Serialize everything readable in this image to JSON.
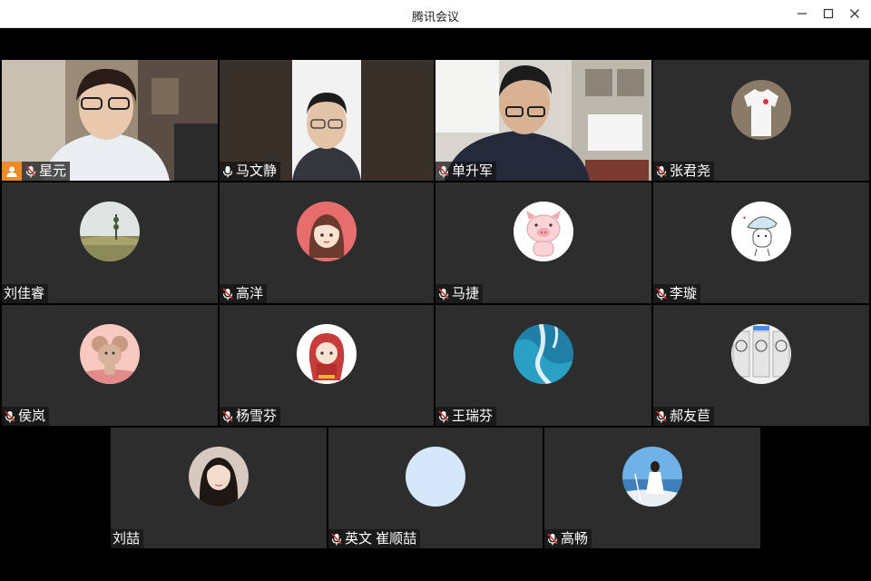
{
  "window": {
    "title": "腾讯会议"
  },
  "controls": [
    "minimize-icon",
    "maximize-icon",
    "close-icon"
  ],
  "participants": [
    {
      "name": "星元",
      "mic": "muted",
      "host": true,
      "video": true
    },
    {
      "name": "马文静",
      "mic": "on",
      "speaking": true,
      "video": true
    },
    {
      "name": "单升军",
      "mic": "muted",
      "video": true
    },
    {
      "name": "张君尧",
      "mic": "muted",
      "avatar": "shirt-avatar"
    },
    {
      "name": "刘佳睿",
      "mic": "none",
      "avatar": "landscape-avatar"
    },
    {
      "name": "高洋",
      "mic": "muted",
      "avatar": "cartoon-girl-avatar"
    },
    {
      "name": "马捷",
      "mic": "muted",
      "avatar": "pig-avatar"
    },
    {
      "name": "李璇",
      "mic": "muted",
      "avatar": "mushroom-avatar"
    },
    {
      "name": "侯岚",
      "mic": "muted",
      "avatar": "mouse-avatar"
    },
    {
      "name": "杨雪芬",
      "mic": "muted",
      "avatar": "red-hood-girl-avatar"
    },
    {
      "name": "王瑞芬",
      "mic": "muted",
      "avatar": "ocean-avatar"
    },
    {
      "name": "郝友苣",
      "mic": "muted",
      "avatar": "meme-avatar"
    },
    {
      "name": "刘喆",
      "mic": "none",
      "avatar": "woman-avatar"
    },
    {
      "name": "英文 崔顺喆",
      "mic": "muted",
      "avatar": "blank-avatar"
    },
    {
      "name": "高畅",
      "mic": "muted",
      "avatar": "beach-avatar"
    }
  ],
  "colors": {
    "host_badge": "#f08a24",
    "active_border": "#3fae4c",
    "tile_bg": "#2d2d2d",
    "muted_mic": "#e0332c"
  }
}
